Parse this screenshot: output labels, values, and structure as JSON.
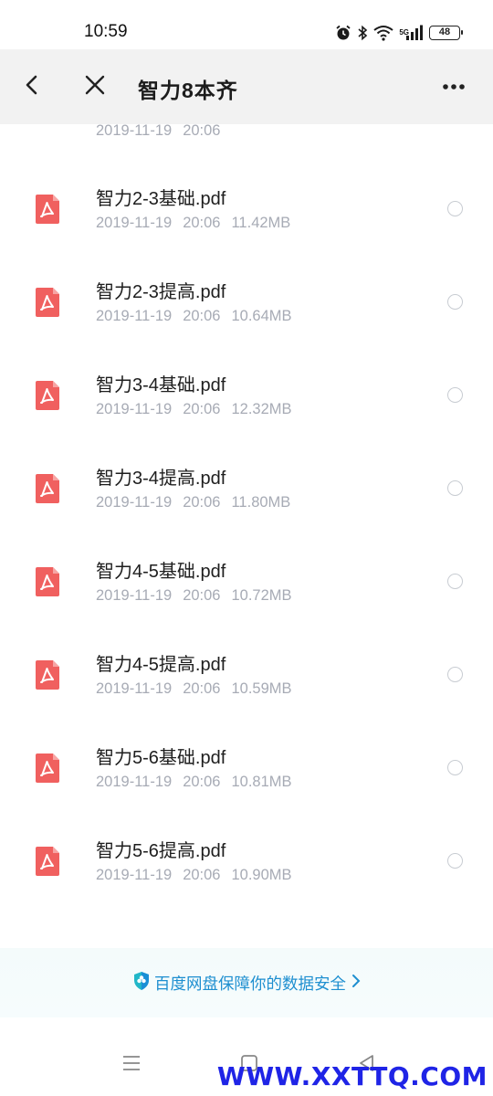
{
  "status_bar": {
    "time": "10:59",
    "icons": [
      "alarm-icon",
      "bluetooth-icon",
      "wifi-icon",
      "cellular-signal-icon",
      "battery-icon"
    ],
    "signal_label": "5G",
    "battery_level": "48"
  },
  "header": {
    "title": "智力8本齐",
    "back_icon": "chevron-left-icon",
    "close_icon": "close-icon",
    "more_icon": "more-horizontal-icon"
  },
  "file_list": {
    "partial_item": {
      "icon": "folder-icon",
      "date": "2019-11-19",
      "time": "20:06"
    },
    "items": [
      {
        "icon": "pdf-icon",
        "name": "智力2-3基础.pdf",
        "date": "2019-11-19",
        "time": "20:06",
        "size": "11.42MB"
      },
      {
        "icon": "pdf-icon",
        "name": "智力2-3提高.pdf",
        "date": "2019-11-19",
        "time": "20:06",
        "size": "10.64MB"
      },
      {
        "icon": "pdf-icon",
        "name": "智力3-4基础.pdf",
        "date": "2019-11-19",
        "time": "20:06",
        "size": "12.32MB"
      },
      {
        "icon": "pdf-icon",
        "name": "智力3-4提高.pdf",
        "date": "2019-11-19",
        "time": "20:06",
        "size": "11.80MB"
      },
      {
        "icon": "pdf-icon",
        "name": "智力4-5基础.pdf",
        "date": "2019-11-19",
        "time": "20:06",
        "size": "10.72MB"
      },
      {
        "icon": "pdf-icon",
        "name": "智力4-5提高.pdf",
        "date": "2019-11-19",
        "time": "20:06",
        "size": "10.59MB"
      },
      {
        "icon": "pdf-icon",
        "name": "智力5-6基础.pdf",
        "date": "2019-11-19",
        "time": "20:06",
        "size": "10.81MB"
      },
      {
        "icon": "pdf-icon",
        "name": "智力5-6提高.pdf",
        "date": "2019-11-19",
        "time": "20:06",
        "size": "10.90MB"
      }
    ]
  },
  "promo": {
    "icon": "shield-icon",
    "text": "百度网盘保障你的数据安全",
    "chevron_icon": "chevron-right-icon"
  },
  "nav_bar": {
    "icons": [
      "menu-icon",
      "home-square-icon",
      "back-triangle-icon"
    ]
  },
  "watermark": "WWW.XXTTQ.COM",
  "colors": {
    "pdf_red": "#f0605f",
    "meta_gray": "#a7abb5",
    "header_bg": "#f2f2f2",
    "promo_blue": "#1e8fd0",
    "watermark_blue": "#1f24e6"
  }
}
